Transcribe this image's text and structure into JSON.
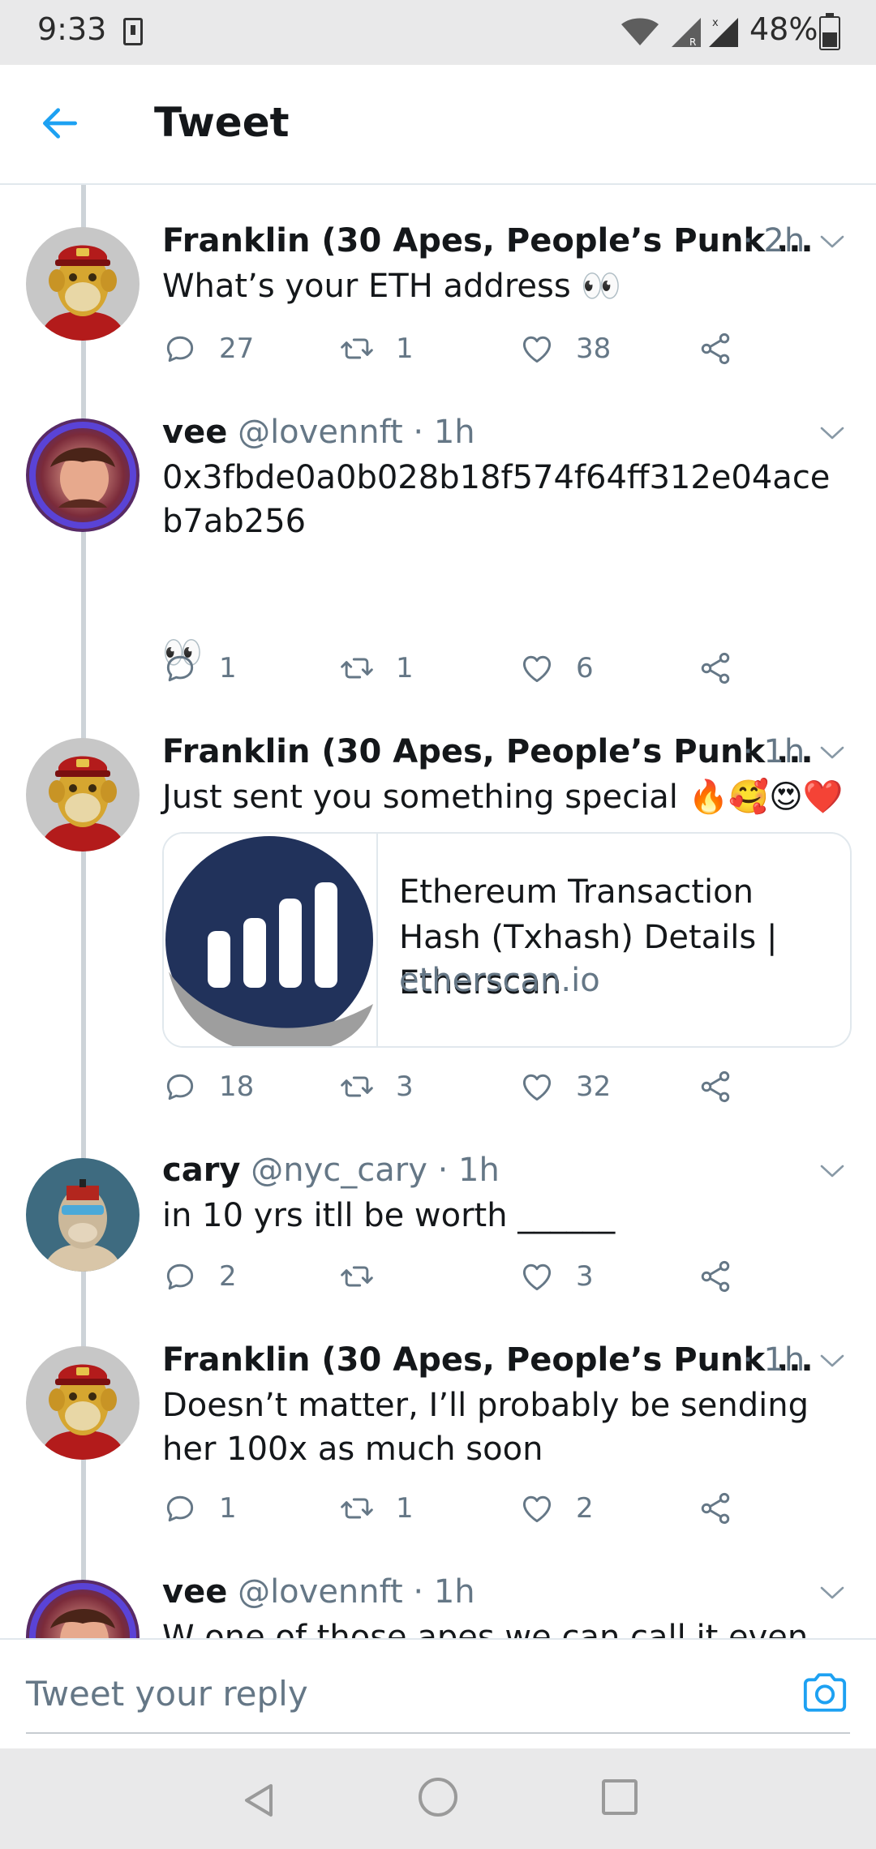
{
  "status_bar": {
    "time": "9:33",
    "battery": "48%"
  },
  "header": {
    "title": "Tweet"
  },
  "tweets": [
    {
      "name": "Franklin (30 Apes, People’s Punk ...",
      "handle": "",
      "meta": "",
      "time": "· 2h",
      "text": "What’s your ETH address 👀",
      "replies": "27",
      "retweets": "1",
      "likes": "38"
    },
    {
      "name": "vee",
      "handle": "@lovennft · 1h",
      "meta": "",
      "time": "",
      "text": "0x3fbde0a0b028b18f574f64ff312e04aceb7ab256\n\n\n👀",
      "replies": "1",
      "retweets": "1",
      "likes": "6"
    },
    {
      "name": "Franklin (30 Apes, People’s Punk ...",
      "handle": "",
      "meta": "",
      "time": "· 1h",
      "text": "Just sent you something special 🔥🥰😍❤️",
      "card": {
        "title": "Ethereum Transaction Hash (Txhash) Details | Etherscan",
        "domain": "etherscan.io"
      },
      "replies": "18",
      "retweets": "3",
      "likes": "32"
    },
    {
      "name": "cary",
      "handle": "@nyc_cary · 1h",
      "meta": "",
      "time": "",
      "text": "in 10 yrs itll be worth ______",
      "replies": "2",
      "retweets": "",
      "likes": "3"
    },
    {
      "name": "Franklin (30 Apes, People’s Punk ...",
      "handle": "",
      "meta": "",
      "time": "· 1h",
      "text": "Doesn’t matter, I’ll probably be sending her 100x as much soon",
      "replies": "1",
      "retweets": "1",
      "likes": "2"
    },
    {
      "name": "vee",
      "handle": "@lovennft · 1h",
      "meta": "",
      "time": "",
      "text": "W one of those apes we can call it even 😌"
    }
  ],
  "reply_bar": {
    "placeholder": "Tweet your reply"
  },
  "icons": {
    "back": "arrow-left-icon",
    "reply": "speech-bubble-icon",
    "retweet": "retweet-icon",
    "like": "heart-icon",
    "share": "share-icon",
    "camera": "camera-icon"
  },
  "colors": {
    "accent": "#1da1f2",
    "muted": "#657786",
    "text": "#14171a",
    "border": "#e1e8ed"
  }
}
